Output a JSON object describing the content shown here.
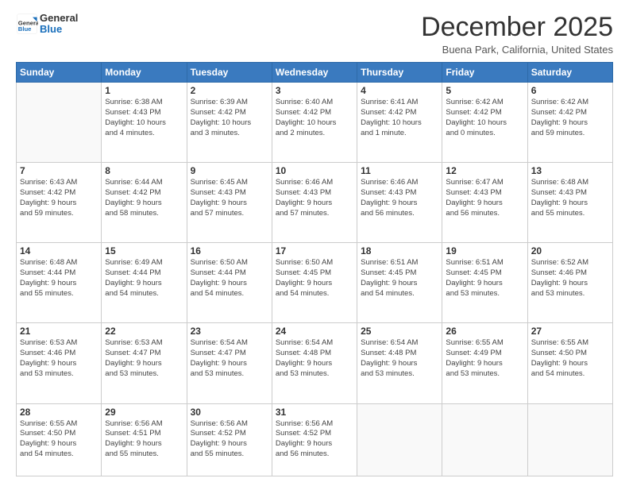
{
  "header": {
    "logo_text_general": "General",
    "logo_text_blue": "Blue",
    "month": "December 2025",
    "location": "Buena Park, California, United States"
  },
  "weekdays": [
    "Sunday",
    "Monday",
    "Tuesday",
    "Wednesday",
    "Thursday",
    "Friday",
    "Saturday"
  ],
  "weeks": [
    [
      {
        "day": "",
        "info": ""
      },
      {
        "day": "1",
        "info": "Sunrise: 6:38 AM\nSunset: 4:43 PM\nDaylight: 10 hours\nand 4 minutes."
      },
      {
        "day": "2",
        "info": "Sunrise: 6:39 AM\nSunset: 4:42 PM\nDaylight: 10 hours\nand 3 minutes."
      },
      {
        "day": "3",
        "info": "Sunrise: 6:40 AM\nSunset: 4:42 PM\nDaylight: 10 hours\nand 2 minutes."
      },
      {
        "day": "4",
        "info": "Sunrise: 6:41 AM\nSunset: 4:42 PM\nDaylight: 10 hours\nand 1 minute."
      },
      {
        "day": "5",
        "info": "Sunrise: 6:42 AM\nSunset: 4:42 PM\nDaylight: 10 hours\nand 0 minutes."
      },
      {
        "day": "6",
        "info": "Sunrise: 6:42 AM\nSunset: 4:42 PM\nDaylight: 9 hours\nand 59 minutes."
      }
    ],
    [
      {
        "day": "7",
        "info": "Sunrise: 6:43 AM\nSunset: 4:42 PM\nDaylight: 9 hours\nand 59 minutes."
      },
      {
        "day": "8",
        "info": "Sunrise: 6:44 AM\nSunset: 4:42 PM\nDaylight: 9 hours\nand 58 minutes."
      },
      {
        "day": "9",
        "info": "Sunrise: 6:45 AM\nSunset: 4:43 PM\nDaylight: 9 hours\nand 57 minutes."
      },
      {
        "day": "10",
        "info": "Sunrise: 6:46 AM\nSunset: 4:43 PM\nDaylight: 9 hours\nand 57 minutes."
      },
      {
        "day": "11",
        "info": "Sunrise: 6:46 AM\nSunset: 4:43 PM\nDaylight: 9 hours\nand 56 minutes."
      },
      {
        "day": "12",
        "info": "Sunrise: 6:47 AM\nSunset: 4:43 PM\nDaylight: 9 hours\nand 56 minutes."
      },
      {
        "day": "13",
        "info": "Sunrise: 6:48 AM\nSunset: 4:43 PM\nDaylight: 9 hours\nand 55 minutes."
      }
    ],
    [
      {
        "day": "14",
        "info": "Sunrise: 6:48 AM\nSunset: 4:44 PM\nDaylight: 9 hours\nand 55 minutes."
      },
      {
        "day": "15",
        "info": "Sunrise: 6:49 AM\nSunset: 4:44 PM\nDaylight: 9 hours\nand 54 minutes."
      },
      {
        "day": "16",
        "info": "Sunrise: 6:50 AM\nSunset: 4:44 PM\nDaylight: 9 hours\nand 54 minutes."
      },
      {
        "day": "17",
        "info": "Sunrise: 6:50 AM\nSunset: 4:45 PM\nDaylight: 9 hours\nand 54 minutes."
      },
      {
        "day": "18",
        "info": "Sunrise: 6:51 AM\nSunset: 4:45 PM\nDaylight: 9 hours\nand 54 minutes."
      },
      {
        "day": "19",
        "info": "Sunrise: 6:51 AM\nSunset: 4:45 PM\nDaylight: 9 hours\nand 53 minutes."
      },
      {
        "day": "20",
        "info": "Sunrise: 6:52 AM\nSunset: 4:46 PM\nDaylight: 9 hours\nand 53 minutes."
      }
    ],
    [
      {
        "day": "21",
        "info": "Sunrise: 6:53 AM\nSunset: 4:46 PM\nDaylight: 9 hours\nand 53 minutes."
      },
      {
        "day": "22",
        "info": "Sunrise: 6:53 AM\nSunset: 4:47 PM\nDaylight: 9 hours\nand 53 minutes."
      },
      {
        "day": "23",
        "info": "Sunrise: 6:54 AM\nSunset: 4:47 PM\nDaylight: 9 hours\nand 53 minutes."
      },
      {
        "day": "24",
        "info": "Sunrise: 6:54 AM\nSunset: 4:48 PM\nDaylight: 9 hours\nand 53 minutes."
      },
      {
        "day": "25",
        "info": "Sunrise: 6:54 AM\nSunset: 4:48 PM\nDaylight: 9 hours\nand 53 minutes."
      },
      {
        "day": "26",
        "info": "Sunrise: 6:55 AM\nSunset: 4:49 PM\nDaylight: 9 hours\nand 53 minutes."
      },
      {
        "day": "27",
        "info": "Sunrise: 6:55 AM\nSunset: 4:50 PM\nDaylight: 9 hours\nand 54 minutes."
      }
    ],
    [
      {
        "day": "28",
        "info": "Sunrise: 6:55 AM\nSunset: 4:50 PM\nDaylight: 9 hours\nand 54 minutes."
      },
      {
        "day": "29",
        "info": "Sunrise: 6:56 AM\nSunset: 4:51 PM\nDaylight: 9 hours\nand 55 minutes."
      },
      {
        "day": "30",
        "info": "Sunrise: 6:56 AM\nSunset: 4:52 PM\nDaylight: 9 hours\nand 55 minutes."
      },
      {
        "day": "31",
        "info": "Sunrise: 6:56 AM\nSunset: 4:52 PM\nDaylight: 9 hours\nand 56 minutes."
      },
      {
        "day": "",
        "info": ""
      },
      {
        "day": "",
        "info": ""
      },
      {
        "day": "",
        "info": ""
      }
    ]
  ]
}
